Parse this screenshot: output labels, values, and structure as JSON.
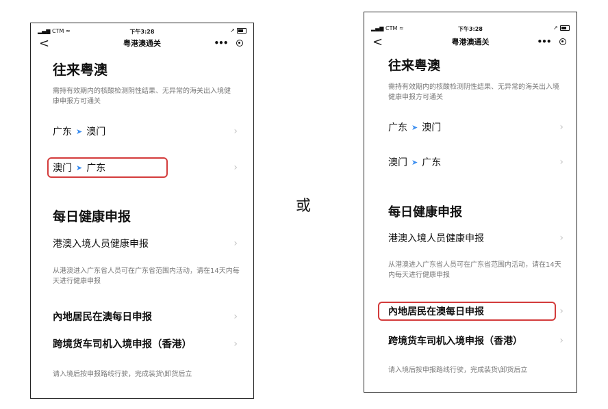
{
  "separator": "或",
  "left": {
    "status": {
      "carrier": "CTM",
      "time": "下午3:28"
    },
    "navbar": {
      "title": "粤港澳通关",
      "back": "<",
      "more": "•••"
    },
    "section1": {
      "title": "往来粤澳",
      "note": "需持有效期内的核酸检测阴性结果、无异常的海关出入境健康申报方可通关",
      "routes": [
        {
          "from": "广东",
          "to": "澳门"
        },
        {
          "from": "澳门",
          "to": "广东"
        }
      ]
    },
    "section2": {
      "title": "每日健康申报",
      "items": [
        {
          "label": "港澳入境人员健康申报",
          "note": "从港澳进入广东省人员可在广东省范围内活动，请在14天内每天进行健康申报"
        },
        {
          "label": "內地居民在澳每日申报"
        },
        {
          "label": "跨境货车司机入境申报（香港）",
          "note": "请入境后按申报路线行驶，完成装货\\卸货后立"
        }
      ]
    }
  },
  "right": {
    "status": {
      "carrier": "CTM",
      "time": "下午3:28"
    },
    "navbar": {
      "title": "粤港澳通关",
      "back": "<",
      "more": "•••"
    },
    "section1": {
      "title": "往来粤澳",
      "note": "需持有效期内的核酸检测阴性结果、无异常的海关出入境健康申报方可通关",
      "routes": [
        {
          "from": "广东",
          "to": "澳门"
        },
        {
          "from": "澳门",
          "to": "广东"
        }
      ]
    },
    "section2": {
      "title": "每日健康申报",
      "items": [
        {
          "label": "港澳入境人员健康申报",
          "note": "从港澳进入广东省人员可在广东省范围内活动，请在14天内每天进行健康申报"
        },
        {
          "label": "內地居民在澳每日申报"
        },
        {
          "label": "跨境货车司机入境申报（香港）",
          "note": "请入境后按申报路线行驶，完成装货\\卸货后立"
        }
      ]
    }
  },
  "colors": {
    "highlight": "#d33b3b",
    "arrow": "#3a8df0",
    "note": "#7a7a7a",
    "chevron": "#c4c4c4"
  }
}
